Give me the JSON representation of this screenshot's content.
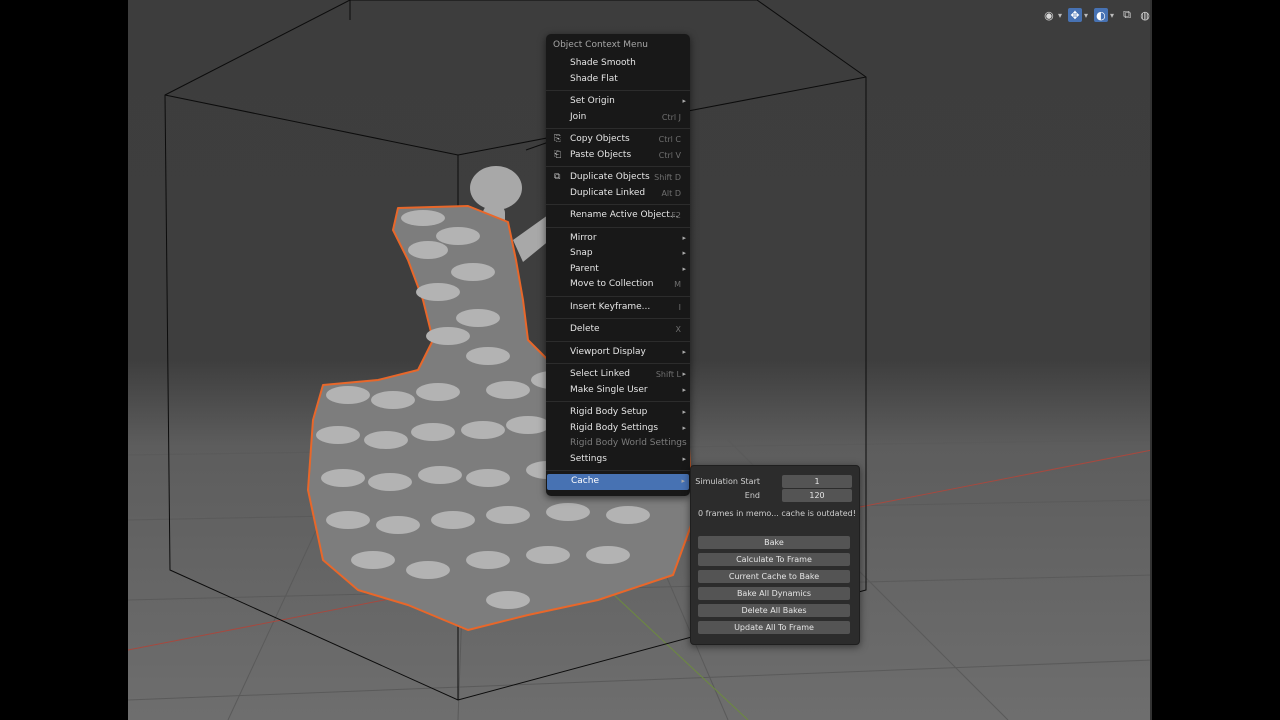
{
  "header": {
    "icons": [
      "eye-icon",
      "gizmo-icon",
      "overlay-icon",
      "xray-icon",
      "solid-shading-icon"
    ]
  },
  "scene": {
    "bg_top": "#3d3d3d",
    "floor": "#6a6a6a",
    "selection_outline": "#e8672a"
  },
  "context_menu": {
    "title": "Object Context Menu",
    "items": [
      {
        "label": "Shade Smooth",
        "shortcut": "",
        "submenu": false
      },
      {
        "label": "Shade Flat",
        "shortcut": "",
        "submenu": false
      },
      {
        "label": "Set Origin",
        "shortcut": "",
        "submenu": true
      },
      {
        "label": "Join",
        "shortcut": "Ctrl J",
        "submenu": false
      },
      {
        "label": "Copy Objects",
        "shortcut": "Ctrl C",
        "submenu": false
      },
      {
        "label": "Paste Objects",
        "shortcut": "Ctrl V",
        "submenu": false
      },
      {
        "label": "Duplicate Objects",
        "shortcut": "Shift D",
        "submenu": false
      },
      {
        "label": "Duplicate Linked",
        "shortcut": "Alt D",
        "submenu": false
      },
      {
        "label": "Rename Active Object...",
        "shortcut": "F2",
        "submenu": false
      },
      {
        "label": "Mirror",
        "shortcut": "",
        "submenu": true
      },
      {
        "label": "Snap",
        "shortcut": "",
        "submenu": true
      },
      {
        "label": "Parent",
        "shortcut": "",
        "submenu": true
      },
      {
        "label": "Move to Collection",
        "shortcut": "M",
        "submenu": false
      },
      {
        "label": "Insert Keyframe...",
        "shortcut": "I",
        "submenu": false
      },
      {
        "label": "Delete",
        "shortcut": "X",
        "submenu": false
      },
      {
        "label": "Viewport Display",
        "shortcut": "",
        "submenu": true
      },
      {
        "label": "Select Linked",
        "shortcut": "Shift L",
        "submenu": true
      },
      {
        "label": "Make Single User",
        "shortcut": "",
        "submenu": true
      },
      {
        "label": "Rigid Body Setup",
        "shortcut": "",
        "submenu": true
      },
      {
        "label": "Rigid Body Settings",
        "shortcut": "",
        "submenu": true
      },
      {
        "label": "Rigid Body World Settings",
        "shortcut": "",
        "submenu": false
      },
      {
        "label": "Settings",
        "shortcut": "",
        "submenu": true
      },
      {
        "label": "Cache",
        "shortcut": "",
        "submenu": true
      }
    ]
  },
  "cache_panel": {
    "simulation_start_label": "Simulation Start",
    "simulation_start_value": "1",
    "end_label": "End",
    "end_value": "120",
    "info": "0 frames in memo... cache is outdated!",
    "buttons": [
      "Bake",
      "Calculate To Frame",
      "Current Cache to Bake",
      "Bake All Dynamics",
      "Delete All Bakes",
      "Update All To Frame"
    ]
  }
}
